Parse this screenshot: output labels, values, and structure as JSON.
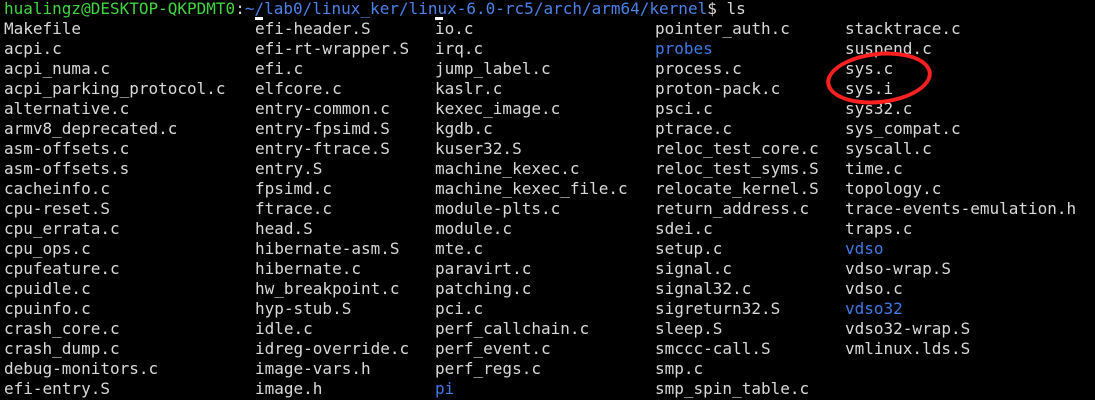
{
  "prompt": {
    "user_host": "hualingz@DESKTOP-QKPDMT0",
    "separator": ":",
    "path": "~/lab0/linux_ker/linux-6.0-rc5/arch/arm64/kernel",
    "command": "$ ls"
  },
  "columns": [
    {
      "entries": [
        {
          "name": "Makefile",
          "type": "file"
        },
        {
          "name": "acpi.c",
          "type": "file"
        },
        {
          "name": "acpi_numa.c",
          "type": "file"
        },
        {
          "name": "acpi_parking_protocol.c",
          "type": "file"
        },
        {
          "name": "alternative.c",
          "type": "file"
        },
        {
          "name": "armv8_deprecated.c",
          "type": "file"
        },
        {
          "name": "asm-offsets.c",
          "type": "file"
        },
        {
          "name": "asm-offsets.s",
          "type": "file"
        },
        {
          "name": "cacheinfo.c",
          "type": "file"
        },
        {
          "name": "cpu-reset.S",
          "type": "file"
        },
        {
          "name": "cpu_errata.c",
          "type": "file"
        },
        {
          "name": "cpu_ops.c",
          "type": "file"
        },
        {
          "name": "cpufeature.c",
          "type": "file"
        },
        {
          "name": "cpuidle.c",
          "type": "file"
        },
        {
          "name": "cpuinfo.c",
          "type": "file"
        },
        {
          "name": "crash_core.c",
          "type": "file"
        },
        {
          "name": "crash_dump.c",
          "type": "file"
        },
        {
          "name": "debug-monitors.c",
          "type": "file"
        },
        {
          "name": "efi-entry.S",
          "type": "file"
        }
      ]
    },
    {
      "entries": [
        {
          "name": "efi-header.S",
          "type": "file"
        },
        {
          "name": "efi-rt-wrapper.S",
          "type": "file"
        },
        {
          "name": "efi.c",
          "type": "file"
        },
        {
          "name": "elfcore.c",
          "type": "file"
        },
        {
          "name": "entry-common.c",
          "type": "file"
        },
        {
          "name": "entry-fpsimd.S",
          "type": "file"
        },
        {
          "name": "entry-ftrace.S",
          "type": "file"
        },
        {
          "name": "entry.S",
          "type": "file"
        },
        {
          "name": "fpsimd.c",
          "type": "file"
        },
        {
          "name": "ftrace.c",
          "type": "file"
        },
        {
          "name": "head.S",
          "type": "file"
        },
        {
          "name": "hibernate-asm.S",
          "type": "file"
        },
        {
          "name": "hibernate.c",
          "type": "file"
        },
        {
          "name": "hw_breakpoint.c",
          "type": "file"
        },
        {
          "name": "hyp-stub.S",
          "type": "file"
        },
        {
          "name": "idle.c",
          "type": "file"
        },
        {
          "name": "idreg-override.c",
          "type": "file"
        },
        {
          "name": "image-vars.h",
          "type": "file"
        },
        {
          "name": "image.h",
          "type": "file"
        }
      ]
    },
    {
      "entries": [
        {
          "name": "io.c",
          "type": "file"
        },
        {
          "name": "irq.c",
          "type": "file"
        },
        {
          "name": "jump_label.c",
          "type": "file"
        },
        {
          "name": "kaslr.c",
          "type": "file"
        },
        {
          "name": "kexec_image.c",
          "type": "file"
        },
        {
          "name": "kgdb.c",
          "type": "file"
        },
        {
          "name": "kuser32.S",
          "type": "file"
        },
        {
          "name": "machine_kexec.c",
          "type": "file"
        },
        {
          "name": "machine_kexec_file.c",
          "type": "file"
        },
        {
          "name": "module-plts.c",
          "type": "file"
        },
        {
          "name": "module.c",
          "type": "file"
        },
        {
          "name": "mte.c",
          "type": "file"
        },
        {
          "name": "paravirt.c",
          "type": "file"
        },
        {
          "name": "patching.c",
          "type": "file"
        },
        {
          "name": "pci.c",
          "type": "file"
        },
        {
          "name": "perf_callchain.c",
          "type": "file"
        },
        {
          "name": "perf_event.c",
          "type": "file"
        },
        {
          "name": "perf_regs.c",
          "type": "file"
        },
        {
          "name": "pi",
          "type": "dir"
        }
      ]
    },
    {
      "entries": [
        {
          "name": "pointer_auth.c",
          "type": "file"
        },
        {
          "name": "probes",
          "type": "dir"
        },
        {
          "name": "process.c",
          "type": "file"
        },
        {
          "name": "proton-pack.c",
          "type": "file"
        },
        {
          "name": "psci.c",
          "type": "file"
        },
        {
          "name": "ptrace.c",
          "type": "file"
        },
        {
          "name": "reloc_test_core.c",
          "type": "file"
        },
        {
          "name": "reloc_test_syms.S",
          "type": "file"
        },
        {
          "name": "relocate_kernel.S",
          "type": "file"
        },
        {
          "name": "return_address.c",
          "type": "file"
        },
        {
          "name": "sdei.c",
          "type": "file"
        },
        {
          "name": "setup.c",
          "type": "file"
        },
        {
          "name": "signal.c",
          "type": "file"
        },
        {
          "name": "signal32.c",
          "type": "file"
        },
        {
          "name": "sigreturn32.S",
          "type": "file"
        },
        {
          "name": "sleep.S",
          "type": "file"
        },
        {
          "name": "smccc-call.S",
          "type": "file"
        },
        {
          "name": "smp.c",
          "type": "file"
        },
        {
          "name": "smp_spin_table.c",
          "type": "file"
        }
      ]
    },
    {
      "entries": [
        {
          "name": "stacktrace.c",
          "type": "file"
        },
        {
          "name": "suspend.c",
          "type": "file"
        },
        {
          "name": "sys.c",
          "type": "file"
        },
        {
          "name": "sys.i",
          "type": "file"
        },
        {
          "name": "sys32.c",
          "type": "file"
        },
        {
          "name": "sys_compat.c",
          "type": "file"
        },
        {
          "name": "syscall.c",
          "type": "file"
        },
        {
          "name": "time.c",
          "type": "file"
        },
        {
          "name": "topology.c",
          "type": "file"
        },
        {
          "name": "trace-events-emulation.h",
          "type": "file"
        },
        {
          "name": "traps.c",
          "type": "file"
        },
        {
          "name": "vdso",
          "type": "dir"
        },
        {
          "name": "vdso-wrap.S",
          "type": "file"
        },
        {
          "name": "vdso.c",
          "type": "file"
        },
        {
          "name": "vdso32",
          "type": "dir"
        },
        {
          "name": "vdso32-wrap.S",
          "type": "file"
        },
        {
          "name": "vmlinux.lds.S",
          "type": "file"
        }
      ]
    }
  ],
  "colors": {
    "background": "#000000",
    "file_text": "#d9d9d9",
    "directory_text": "#3f79e6",
    "prompt_user": "#3fd63f",
    "prompt_path": "#4a82e8",
    "annotation": "#ff2020"
  }
}
